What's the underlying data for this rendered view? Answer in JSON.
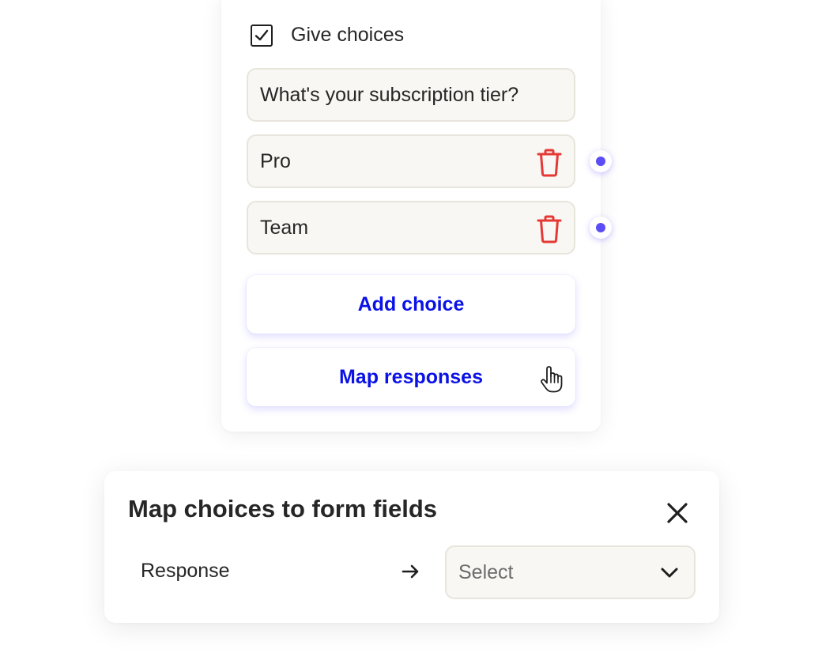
{
  "choices_card": {
    "give_choices_label": "Give choices",
    "give_choices_checked": true,
    "question_value": "What's your subscription tier?",
    "choices": [
      {
        "value": "Pro"
      },
      {
        "value": "Team"
      }
    ],
    "add_choice_label": "Add choice",
    "map_responses_label": "Map responses"
  },
  "map_panel": {
    "title": "Map choices to form fields",
    "response_label": "Response",
    "select_placeholder": "Select"
  },
  "icons": {
    "checkbox": "check-icon",
    "delete": "trash-icon",
    "connector": "connector-dot",
    "cursor": "hand-pointer-icon",
    "close": "close-icon",
    "arrow": "arrow-right-icon",
    "dropdown": "chevron-down-icon"
  },
  "colors": {
    "accent_text": "#0a12e6",
    "connector_dot": "#5b4cf5",
    "delete_icon": "#e53935",
    "field_background": "#f8f7f3",
    "field_border": "#e8e5dc"
  }
}
